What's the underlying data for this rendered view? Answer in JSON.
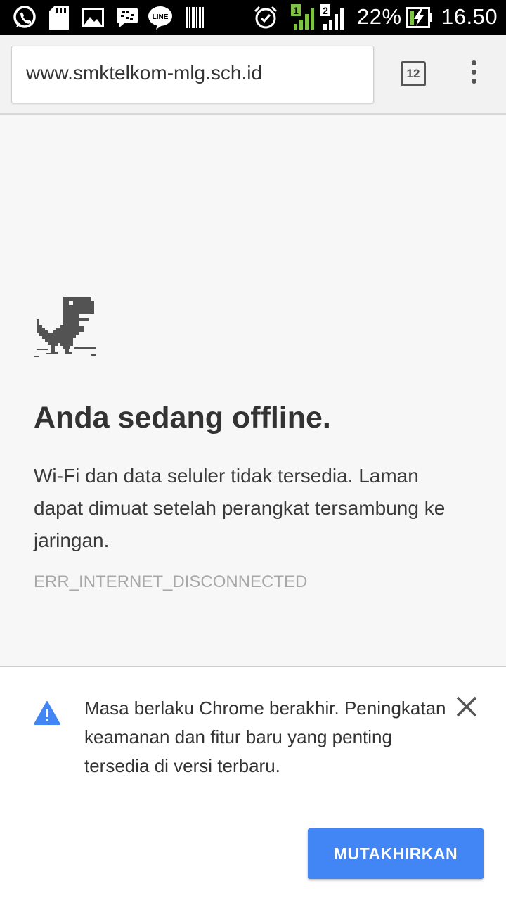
{
  "status_bar": {
    "battery_percent": "22%",
    "time": "16.50",
    "sim1_label": "1",
    "sim2_label": "2",
    "line_label": "LINE",
    "icons": [
      "whatsapp-icon",
      "sd-card-icon",
      "image-icon",
      "bbm-icon",
      "line-icon",
      "barcode-icon",
      "alarm-icon",
      "signal-sim1-icon",
      "signal-sim2-icon",
      "battery-charging-icon"
    ],
    "colors": {
      "sim1_signal": "#7dc242",
      "background": "#000000"
    }
  },
  "toolbar": {
    "url": "www.smktelkom-mlg.sch.id",
    "tab_count": "12",
    "menu_icon": "more-vert-icon"
  },
  "page": {
    "title": "Anda sedang offline.",
    "description": "Wi-Fi dan data seluler tidak tersedia. Laman dapat dimuat setelah perangkat tersambung ke jaringan.",
    "error_code": "ERR_INTERNET_DISCONNECTED",
    "illustration": "dinosaur-icon"
  },
  "infobar": {
    "message": "Masa berlaku Chrome berakhir. Peningkatan keamanan dan fitur baru yang penting tersedia di versi terbaru.",
    "button_label": "MUTAKHIRKAN",
    "icons": [
      "warning-icon",
      "close-icon"
    ],
    "colors": {
      "button": "#4285f4",
      "warning": "#4285f4"
    }
  }
}
